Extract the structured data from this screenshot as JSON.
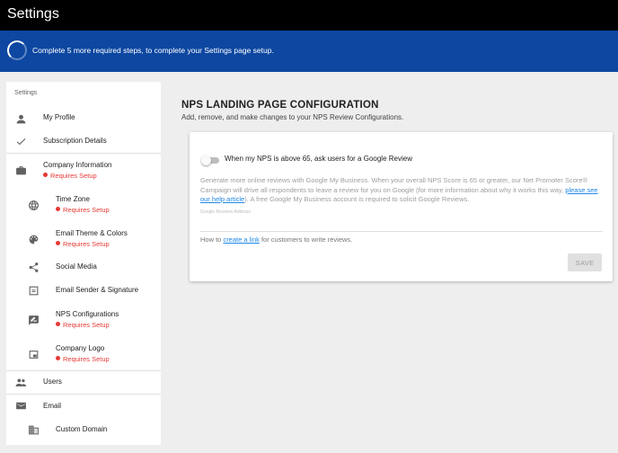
{
  "app": {
    "title": "Settings"
  },
  "banner": {
    "message": "Complete 5 more required steps, to complete your Settings page setup.",
    "icon": "progress-spinner-icon"
  },
  "sidebar": {
    "heading": "Settings",
    "requires_setup_label": "Requires Setup",
    "items": [
      {
        "label": "My Profile",
        "icon": "person-icon"
      },
      {
        "label": "Subscription Details",
        "icon": "check-icon"
      },
      {
        "label": "Company Information",
        "icon": "briefcase-icon",
        "status": "Requires Setup"
      },
      {
        "label": "Time Zone",
        "icon": "globe-icon",
        "status": "Requires Setup"
      },
      {
        "label": "Email Theme & Colors",
        "icon": "palette-icon",
        "status": "Requires Setup"
      },
      {
        "label": "Social Media",
        "icon": "share-icon"
      },
      {
        "label": "Email Sender & Signature",
        "icon": "signature-icon"
      },
      {
        "label": "NPS Configurations",
        "icon": "rate-review-icon",
        "status": "Requires Setup"
      },
      {
        "label": "Company Logo",
        "icon": "image-icon",
        "status": "Requires Setup"
      },
      {
        "label": "Users",
        "icon": "people-icon"
      },
      {
        "label": "Email",
        "icon": "mail-icon"
      },
      {
        "label": "Custom Domain",
        "icon": "domain-icon"
      }
    ]
  },
  "main": {
    "title": "NPS LANDING PAGE CONFIGURATION",
    "subtitle": "Add, remove, and make changes to your NPS Review Configurations."
  },
  "card": {
    "toggle_label": "When my NPS is above 65, ask users for a Google Review",
    "toggle_on": false,
    "description_before": "Generate more online reviews with Google My Business. When your overall NPS Score is 65 or greater, our Net Promoter Score® Campaign will drive all respondents to leave a review for you on Google (for more information about why it works this way, ",
    "description_link": "please see our help article",
    "description_after": "). A free Google My Business account is required to solicit Google Reviews.",
    "field_label": "Google Reviews Address",
    "field_value": "",
    "howto_before": "How to ",
    "howto_link": "create a link",
    "howto_after": " for customers to write reviews.",
    "save_label": "SAVE"
  },
  "colors": {
    "topbar": "#000000",
    "banner": "#0d47a1",
    "requires_setup": "#e53935",
    "link": "#1e88e5"
  }
}
